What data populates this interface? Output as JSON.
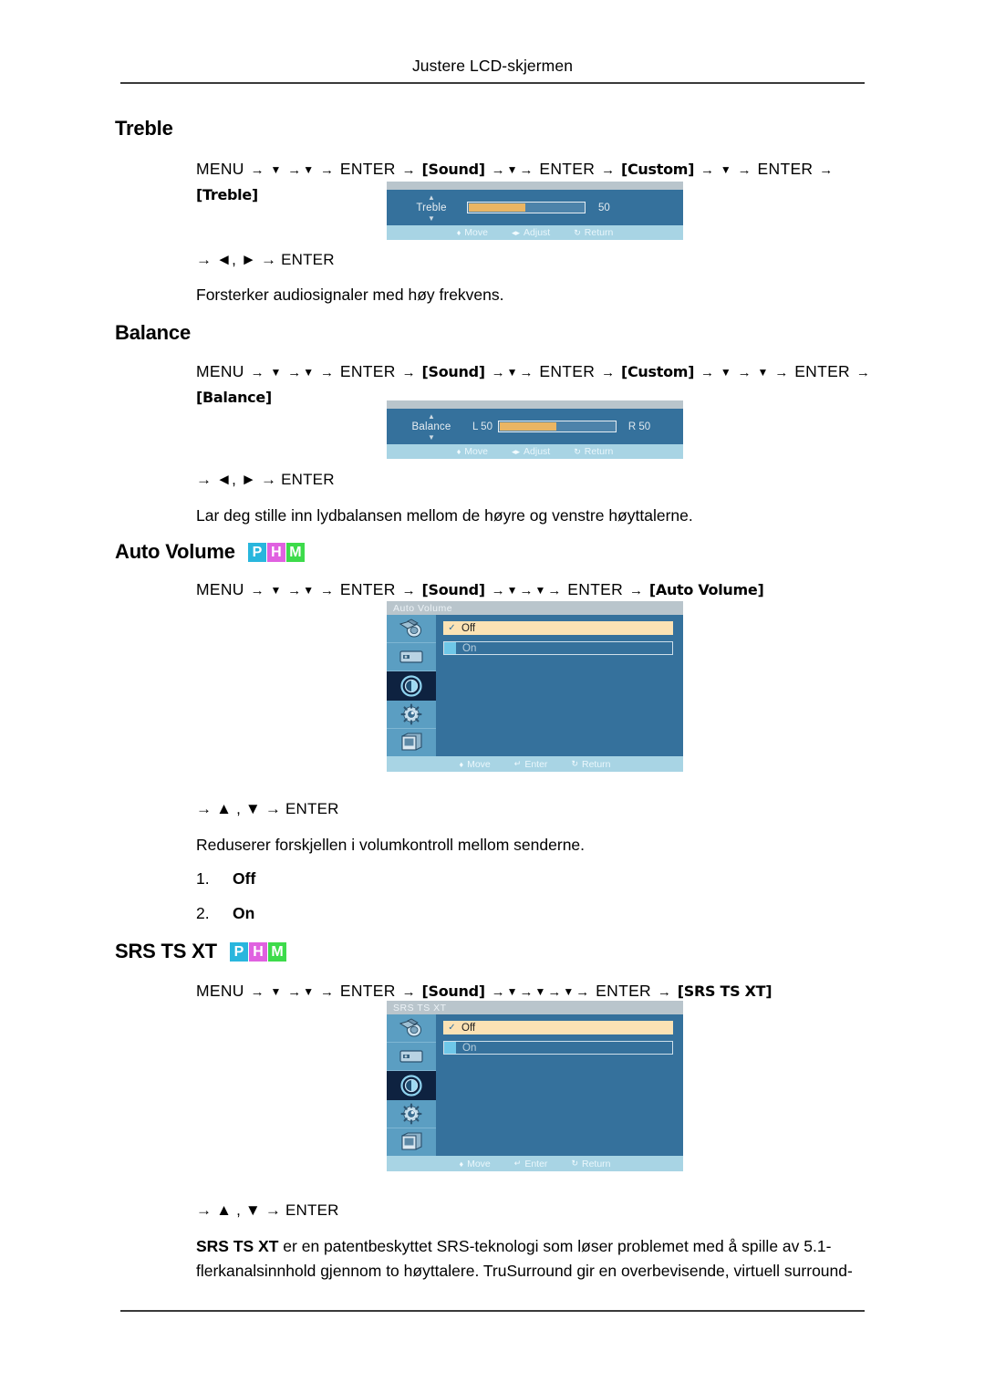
{
  "page": {
    "running_head": "Justere LCD-skjermen"
  },
  "sections": [
    {
      "id": "treble",
      "heading": "Treble",
      "badges": [],
      "path": {
        "parts": [
          "MENU",
          "▼",
          "▼",
          "ENTER",
          "[Sound]",
          "▼",
          "ENTER",
          "[Custom]",
          "▼",
          "ENTER",
          "[Treble]"
        ],
        "menu_label": "MENU",
        "enter_label": "ENTER",
        "sound_token": "Sound",
        "custom_token": "Custom",
        "final_token": "Treble"
      },
      "keys": "→ ◄, ► → ENTER",
      "description": "Forsterker audiosignaler med høy frekvens.",
      "osd": {
        "kind": "slider",
        "label": "Treble",
        "value": "50",
        "fill_percent": 50,
        "footer": [
          {
            "icon": "move-icon",
            "label": "Move"
          },
          {
            "icon": "adjust-icon",
            "label": "Adjust"
          },
          {
            "icon": "return-icon",
            "label": "Return"
          }
        ]
      }
    },
    {
      "id": "balance",
      "heading": "Balance",
      "badges": [],
      "path": {
        "menu_label": "MENU",
        "enter_label": "ENTER",
        "sound_token": "Sound",
        "custom_token": "Custom",
        "final_token": "Balance"
      },
      "keys": "→ ◄, ► → ENTER",
      "description": "Lar deg stille inn lydbalansen mellom de høyre og venstre høyttalerne.",
      "osd": {
        "kind": "slider",
        "label": "Balance",
        "left_label": "L  50",
        "right_label": "R  50",
        "fill_percent": 50,
        "footer": [
          {
            "icon": "move-icon",
            "label": "Move"
          },
          {
            "icon": "adjust-icon",
            "label": "Adjust"
          },
          {
            "icon": "return-icon",
            "label": "Return"
          }
        ]
      }
    },
    {
      "id": "auto-volume",
      "heading": "Auto Volume",
      "badges": [
        "P",
        "H",
        "M"
      ],
      "path": {
        "menu_label": "MENU",
        "enter_label": "ENTER",
        "sound_token": "Sound",
        "final_token": "Auto Volume"
      },
      "keys": "→ ▲ , ▼ → ENTER",
      "description": "Reduserer forskjellen i volumkontroll mellom senderne.",
      "numbered": [
        {
          "num": "1.",
          "text": "Off"
        },
        {
          "num": "2.",
          "text": "On"
        }
      ],
      "osd": {
        "kind": "menu",
        "title": "Auto Volume",
        "icons": [
          "picture-icon",
          "screen-icon",
          "sound-icon",
          "setup-icon",
          "multi-control-icon"
        ],
        "active_icon_index": 2,
        "options": [
          {
            "label": "Off",
            "selected": true
          },
          {
            "label": "On",
            "selected": false
          }
        ],
        "footer": [
          {
            "icon": "move-icon",
            "label": "Move"
          },
          {
            "icon": "enter-icon",
            "label": "Enter"
          },
          {
            "icon": "return-icon",
            "label": "Return"
          }
        ]
      }
    },
    {
      "id": "srs-ts-xt",
      "heading": "SRS TS XT",
      "badges": [
        "P",
        "H",
        "M"
      ],
      "path": {
        "menu_label": "MENU",
        "enter_label": "ENTER",
        "sound_token": "Sound",
        "final_token": "SRS TS XT"
      },
      "keys": "→ ▲ , ▼ → ENTER",
      "body_bold": "SRS TS XT",
      "body_rest": " er en patentbeskyttet SRS-teknologi som løser problemet med å spille av 5.1-flerkanalsinnhold gjennom to høyttalere. TruSurround gir en overbevisende, virtuell surround-",
      "osd": {
        "kind": "menu",
        "title": "SRS TS XT",
        "icons": [
          "picture-icon",
          "screen-icon",
          "sound-icon",
          "setup-icon",
          "multi-control-icon"
        ],
        "active_icon_index": 2,
        "options": [
          {
            "label": "Off",
            "selected": true
          },
          {
            "label": "On",
            "selected": false
          }
        ],
        "footer": [
          {
            "icon": "move-icon",
            "label": "Move"
          },
          {
            "icon": "enter-icon",
            "label": "Enter"
          },
          {
            "icon": "return-icon",
            "label": "Return"
          }
        ]
      }
    }
  ],
  "colors": {
    "osd_blue": "#35719c",
    "osd_icon_col": "#5b9ec2",
    "osd_active": "#0e2240",
    "osd_footer": "#a8d4e4",
    "slider_fill": "#eab563",
    "option_selected": "#fbe2b4",
    "badge_p": "#29b6dd",
    "badge_h": "#e061e0",
    "badge_m": "#3ddb4b"
  }
}
